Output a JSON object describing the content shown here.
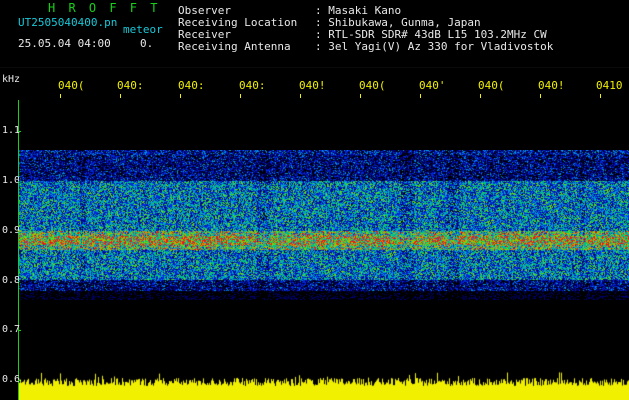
{
  "header": {
    "brand": "H R O F F T",
    "file": "UT2505040400.pn",
    "meteor": "meteor",
    "date_time": "25.05.04 04:00",
    "channel": "0."
  },
  "station": [
    {
      "label": "Observer",
      "value": ": Masaki Kano"
    },
    {
      "label": "Receiving Location",
      "value": ": Shibukawa, Gunma, Japan"
    },
    {
      "label": "Receiver",
      "value": ": RTL-SDR SDR# 43dB L15 103.2MHz CW"
    },
    {
      "label": "Receiving Antenna",
      "value": ": 3el Yagi(V) Az 330 for Vladivostok"
    }
  ],
  "time_axis": {
    "ticks": [
      "040(",
      "040:",
      "040:",
      "040:",
      "040!",
      "040(",
      "040'",
      "040(",
      "040!",
      "0410"
    ]
  },
  "freq_axis": {
    "unit": "kHz",
    "ticks": [
      "1.1",
      "1.0",
      "0.9",
      "0.8",
      "0.7",
      "0.6"
    ]
  },
  "colors": {
    "background": "#000000",
    "text_green": "#18d018",
    "text_cyan": "#18c8d8",
    "tick_yellow": "#f0f000",
    "power_trace": "#f0f000"
  }
}
